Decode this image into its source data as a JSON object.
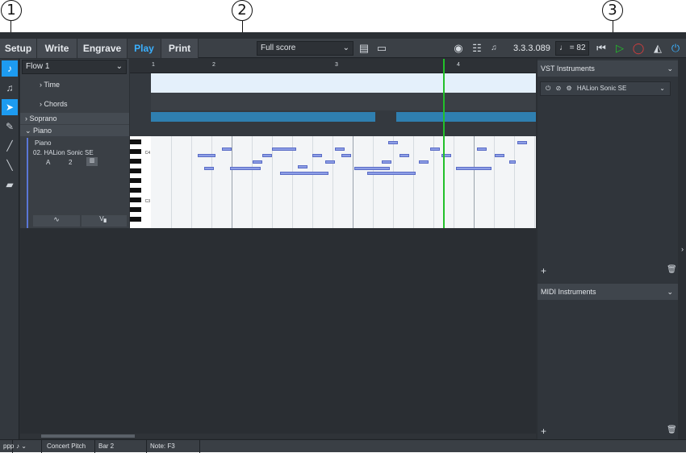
{
  "callouts": [
    "1",
    "2",
    "3"
  ],
  "tabs": [
    "Setup",
    "Write",
    "Engrave",
    "Play",
    "Print"
  ],
  "layout_select": "Full score",
  "position": "3.3.3.089",
  "tempo": "= 82",
  "flow_select": "Flow 1",
  "tracks": {
    "time": "Time",
    "chords": "Chords",
    "soprano": "Soprano",
    "piano": "Piano"
  },
  "instrument": {
    "name": "Piano",
    "device": "02. HALion Sonic SE",
    "channel_a": "A",
    "channel_num": "2"
  },
  "ruler": [
    "1",
    "2",
    "3",
    "4"
  ],
  "piano_labels": [
    "C4",
    "C3"
  ],
  "vst_panel": {
    "title": "VST Instruments",
    "device": "HALion Sonic SE"
  },
  "midi_panel": {
    "title": "MIDI Instruments"
  },
  "status": {
    "pitch": "Concert Pitch",
    "bar": "Bar 2",
    "note": "Note: F3"
  },
  "colors": {
    "accent": "#1d9bf0",
    "playhead": "#22c02a",
    "record": "#e03c3c"
  }
}
